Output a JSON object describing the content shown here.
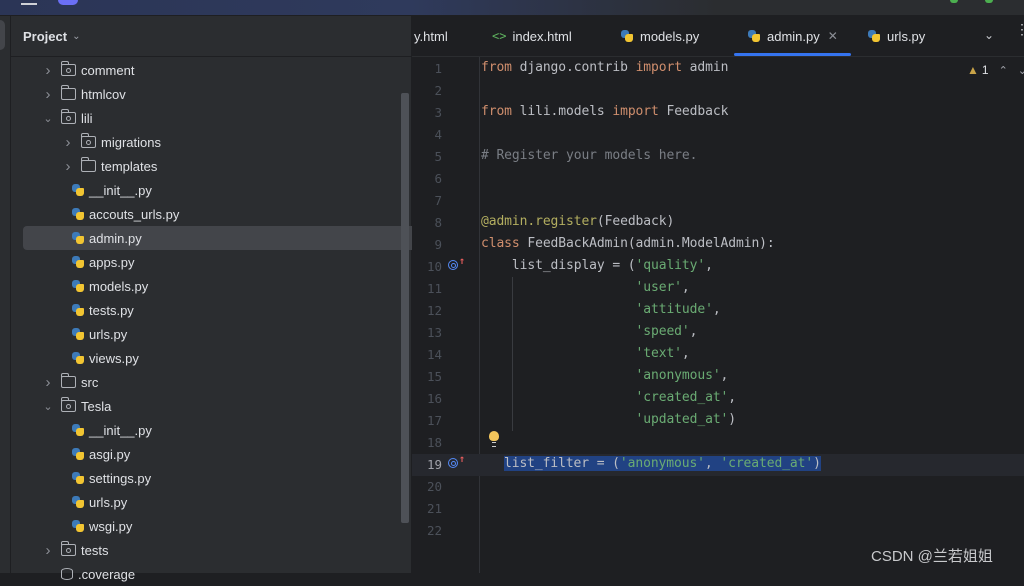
{
  "project_panel": {
    "title": "Project",
    "tree": [
      {
        "label": "comment",
        "type": "package",
        "depth": 1,
        "expanded": false
      },
      {
        "label": "htmlcov",
        "type": "folder",
        "depth": 1,
        "expanded": false
      },
      {
        "label": "lili",
        "type": "package",
        "depth": 1,
        "expanded": true
      },
      {
        "label": "migrations",
        "type": "package",
        "depth": 2,
        "expanded": false
      },
      {
        "label": "templates",
        "type": "folder",
        "depth": 2,
        "expanded": false
      },
      {
        "label": "__init__.py",
        "type": "python",
        "depth": 2
      },
      {
        "label": "accouts_urls.py",
        "type": "python",
        "depth": 2
      },
      {
        "label": "admin.py",
        "type": "python",
        "depth": 2,
        "selected": true
      },
      {
        "label": "apps.py",
        "type": "python",
        "depth": 2
      },
      {
        "label": "models.py",
        "type": "python",
        "depth": 2
      },
      {
        "label": "tests.py",
        "type": "python",
        "depth": 2
      },
      {
        "label": "urls.py",
        "type": "python",
        "depth": 2
      },
      {
        "label": "views.py",
        "type": "python",
        "depth": 2
      },
      {
        "label": "src",
        "type": "folder",
        "depth": 1,
        "expanded": false
      },
      {
        "label": "Tesla",
        "type": "package",
        "depth": 1,
        "expanded": true
      },
      {
        "label": "__init__.py",
        "type": "python",
        "depth": 2
      },
      {
        "label": "asgi.py",
        "type": "python",
        "depth": 2
      },
      {
        "label": "settings.py",
        "type": "python",
        "depth": 2
      },
      {
        "label": "urls.py",
        "type": "python",
        "depth": 2
      },
      {
        "label": "wsgi.py",
        "type": "python",
        "depth": 2
      },
      {
        "label": "tests",
        "type": "package",
        "depth": 1,
        "expanded": false
      },
      {
        "label": ".coverage",
        "type": "db",
        "depth": 1
      }
    ]
  },
  "tabs": [
    {
      "label": "y.html",
      "icon": "none"
    },
    {
      "label": "index.html",
      "icon": "html"
    },
    {
      "label": "models.py",
      "icon": "python"
    },
    {
      "label": "admin.py",
      "icon": "python",
      "active": true
    },
    {
      "label": "urls.py",
      "icon": "python"
    }
  ],
  "editor": {
    "warnings_count": "1",
    "current_line": 19,
    "lines": [
      {
        "n": "1"
      },
      {
        "n": "2"
      },
      {
        "n": "3"
      },
      {
        "n": "4"
      },
      {
        "n": "5"
      },
      {
        "n": "6"
      },
      {
        "n": "7"
      },
      {
        "n": "8"
      },
      {
        "n": "9"
      },
      {
        "n": "10"
      },
      {
        "n": "11"
      },
      {
        "n": "12"
      },
      {
        "n": "13"
      },
      {
        "n": "14"
      },
      {
        "n": "15"
      },
      {
        "n": "16"
      },
      {
        "n": "17"
      },
      {
        "n": "18"
      },
      {
        "n": "19"
      },
      {
        "n": "20"
      },
      {
        "n": "21"
      },
      {
        "n": "22"
      }
    ],
    "code": {
      "l1": [
        "from",
        " django.contrib ",
        "import",
        " admin"
      ],
      "l3": [
        "from",
        " lili.models ",
        "import",
        " Feedback"
      ],
      "l5": "# Register your models here.",
      "l8": [
        "@admin.register",
        "(Feedback)"
      ],
      "l9": [
        "class",
        " FeedBackAdmin(admin.ModelAdmin):"
      ],
      "l10": [
        "    list_display = (",
        "'quality'",
        ","
      ],
      "l11": [
        "                    ",
        "'user'",
        ","
      ],
      "l12": [
        "                    ",
        "'attitude'",
        ","
      ],
      "l13": [
        "                    ",
        "'speed'",
        ","
      ],
      "l14": [
        "                    ",
        "'text'",
        ","
      ],
      "l15": [
        "                    ",
        "'anonymous'",
        ","
      ],
      "l16": [
        "                    ",
        "'created_at'",
        ","
      ],
      "l17": [
        "                    ",
        "'updated_at'",
        ")"
      ],
      "l19": [
        "list_filter = (",
        "'anonymous'",
        ", ",
        "'created_at'",
        ")"
      ]
    }
  },
  "watermark": "CSDN @兰若姐姐"
}
